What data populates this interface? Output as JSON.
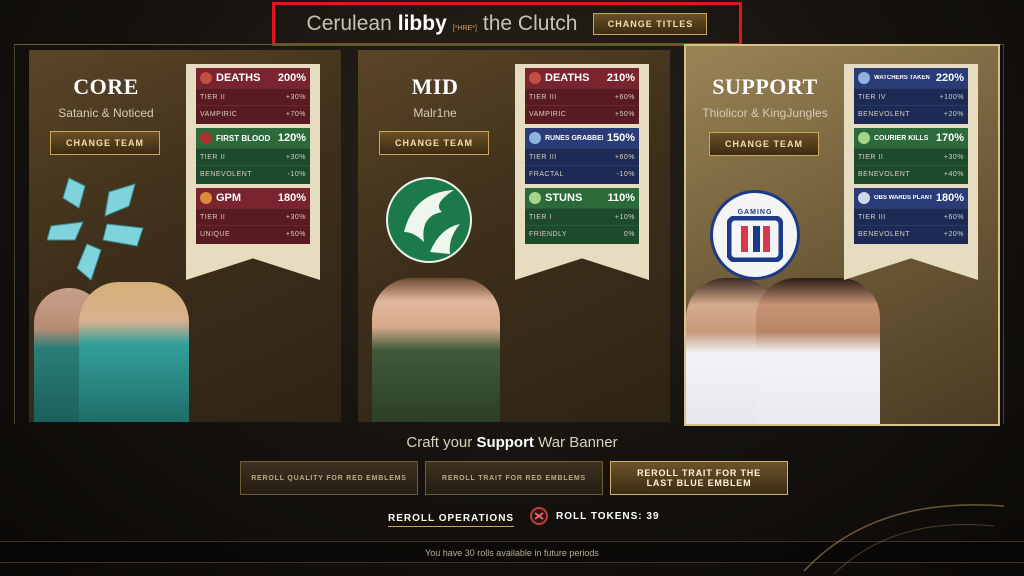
{
  "header": {
    "prefix": "Cerulean",
    "name": "libby",
    "team_tag": "[*HRE*]",
    "suffix": "the Clutch",
    "change_titles_label": "CHANGE TITLES"
  },
  "cards": {
    "core": {
      "role": "CORE",
      "players": "Satanic & Noticed",
      "change_team_label": "CHANGE TEAM",
      "emblems": [
        {
          "name": "DEATHS",
          "pct": "200%",
          "rows": [
            [
              "TIER II",
              "+30%"
            ],
            [
              "VAMPIRIC",
              "+70%"
            ]
          ],
          "color": "red"
        },
        {
          "name": "FIRST BLOOD",
          "pct": "120%",
          "rows": [
            [
              "TIER II",
              "+30%"
            ],
            [
              "BENEVOLENT",
              "-10%"
            ]
          ],
          "color": "green"
        },
        {
          "name": "GPM",
          "pct": "180%",
          "rows": [
            [
              "TIER II",
              "+30%"
            ],
            [
              "UNIQUE",
              "+50%"
            ]
          ],
          "color": "red"
        }
      ]
    },
    "mid": {
      "role": "MID",
      "players": "Malr1ne",
      "change_team_label": "CHANGE TEAM",
      "emblems": [
        {
          "name": "DEATHS",
          "pct": "210%",
          "rows": [
            [
              "TIER III",
              "+60%"
            ],
            [
              "VAMPIRIC",
              "+50%"
            ]
          ],
          "color": "red"
        },
        {
          "name": "RUNES GRABBED",
          "pct": "150%",
          "rows": [
            [
              "TIER III",
              "+60%"
            ],
            [
              "FRACTAL",
              "-10%"
            ]
          ],
          "color": "blue"
        },
        {
          "name": "STUNS",
          "pct": "110%",
          "rows": [
            [
              "TIER I",
              "+10%"
            ],
            [
              "FRIENDLY",
              "0%"
            ]
          ],
          "color": "green"
        }
      ]
    },
    "support": {
      "role": "SUPPORT",
      "players": "Thiolicor & KingJungles",
      "change_team_label": "CHANGE TEAM",
      "logo_text": "GAMING",
      "emblems": [
        {
          "name": "WATCHERS TAKEN",
          "pct": "220%",
          "rows": [
            [
              "TIER IV",
              "+100%"
            ],
            [
              "BENEVOLENT",
              "+20%"
            ]
          ],
          "color": "blue"
        },
        {
          "name": "COURIER KILLS",
          "pct": "170%",
          "rows": [
            [
              "TIER II",
              "+30%"
            ],
            [
              "BENEVOLENT",
              "+40%"
            ]
          ],
          "color": "green"
        },
        {
          "name": "OBS WARDS PLANTED",
          "pct": "180%",
          "rows": [
            [
              "TIER III",
              "+60%"
            ],
            [
              "BENEVOLENT",
              "+20%"
            ]
          ],
          "color": "blue"
        }
      ]
    }
  },
  "craft": {
    "prefix": "Craft your",
    "role": "Support",
    "suffix": "War Banner",
    "buttons": [
      "REROLL QUALITY FOR RED EMBLEMS",
      "REROLL TRAIT FOR RED EMBLEMS",
      "REROLL TRAIT FOR THE LAST BLUE EMBLEM"
    ]
  },
  "operations": {
    "label": "REROLL OPERATIONS",
    "tokens_label": "ROLL TOKENS: 39"
  },
  "footer": {
    "text": "You have 30 rolls available in future periods"
  },
  "colors": {
    "red": "#7a2430",
    "green": "#2c6a3a",
    "blue": "#2a3c78",
    "gold": "#c9a65a",
    "highlight": "#e0161c"
  }
}
